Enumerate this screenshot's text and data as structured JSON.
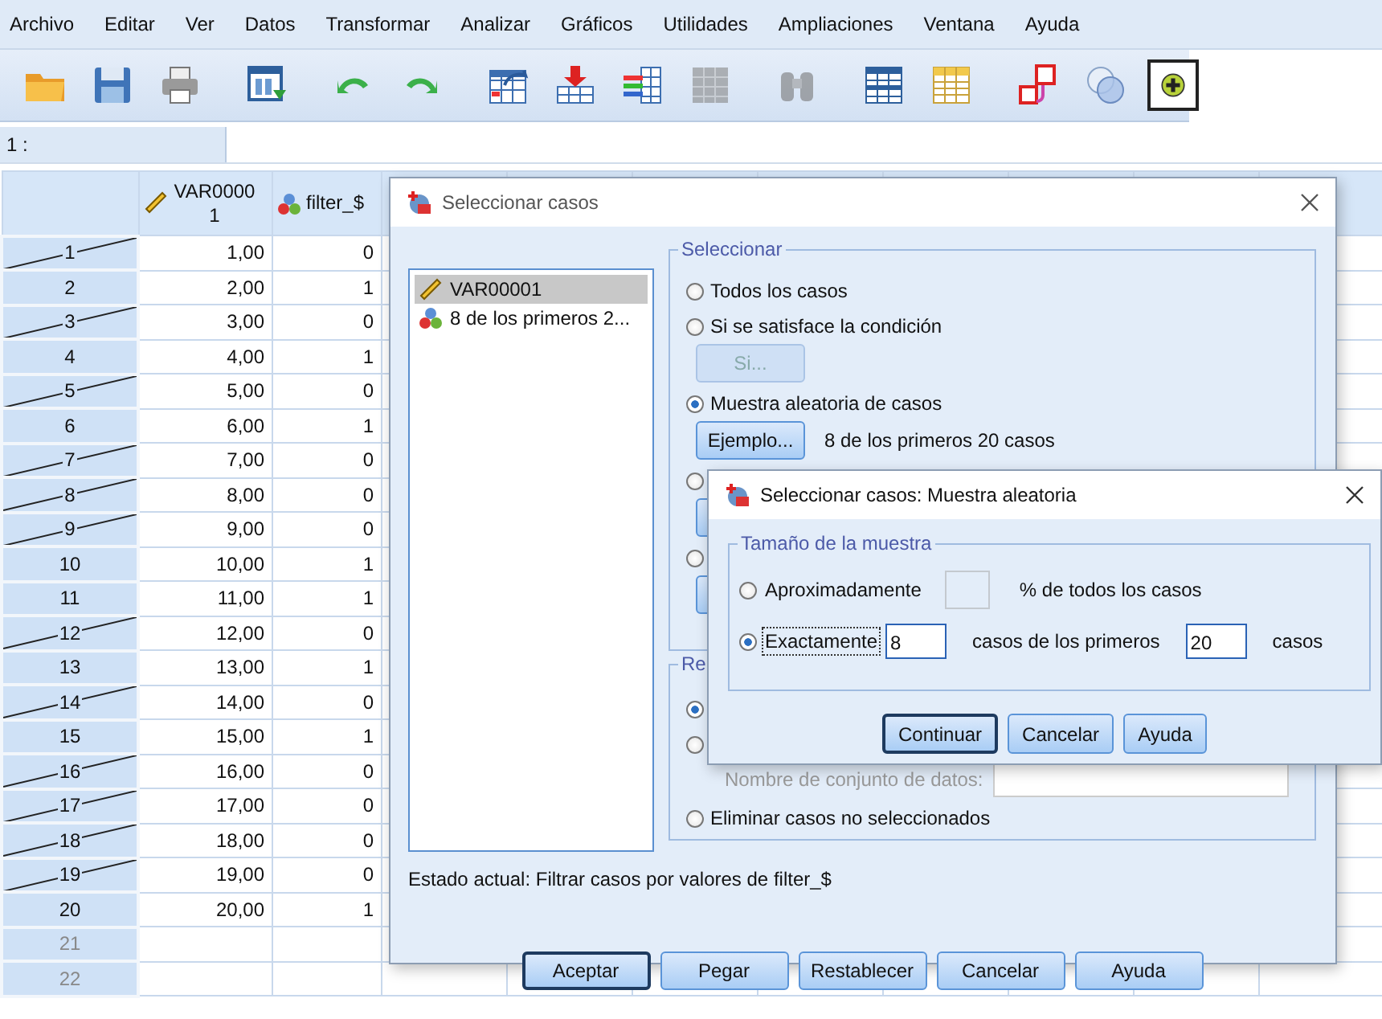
{
  "menu": [
    "Archivo",
    "Editar",
    "Ver",
    "Datos",
    "Transformar",
    "Analizar",
    "Gráficos",
    "Utilidades",
    "Ampliaciones",
    "Ventana",
    "Ayuda"
  ],
  "toolbar": [
    {
      "disabled": false,
      "pressed": false
    },
    {
      "disabled": false,
      "pressed": false
    },
    {
      "disabled": false,
      "pressed": false
    },
    {
      "disabled": false,
      "pressed": false
    },
    {
      "disabled": false,
      "pressed": false
    },
    {
      "disabled": false,
      "pressed": false
    },
    {
      "disabled": false,
      "pressed": false
    },
    {
      "disabled": false,
      "pressed": false
    },
    {
      "disabled": false,
      "pressed": false
    },
    {
      "disabled": true,
      "pressed": false
    },
    {
      "disabled": true,
      "pressed": false
    },
    {
      "disabled": false,
      "pressed": false
    },
    {
      "disabled": false,
      "pressed": false
    },
    {
      "disabled": false,
      "pressed": false
    },
    {
      "disabled": false,
      "pressed": false
    },
    {
      "disabled": false,
      "pressed": true
    }
  ],
  "cell_ref": "1 :",
  "grid": {
    "columns": [
      {
        "name": "VAR00001",
        "kind": "scale"
      },
      {
        "name": "filter_$",
        "kind": "nominal"
      }
    ],
    "rows": [
      {
        "number": "1",
        "filtered_out": true,
        "values": [
          "1,00",
          "0"
        ]
      },
      {
        "number": "2",
        "filtered_out": false,
        "values": [
          "2,00",
          "1"
        ]
      },
      {
        "number": "3",
        "filtered_out": true,
        "values": [
          "3,00",
          "0"
        ]
      },
      {
        "number": "4",
        "filtered_out": false,
        "values": [
          "4,00",
          "1"
        ]
      },
      {
        "number": "5",
        "filtered_out": true,
        "values": [
          "5,00",
          "0"
        ]
      },
      {
        "number": "6",
        "filtered_out": false,
        "values": [
          "6,00",
          "1"
        ]
      },
      {
        "number": "7",
        "filtered_out": true,
        "values": [
          "7,00",
          "0"
        ]
      },
      {
        "number": "8",
        "filtered_out": true,
        "values": [
          "8,00",
          "0"
        ]
      },
      {
        "number": "9",
        "filtered_out": true,
        "values": [
          "9,00",
          "0"
        ]
      },
      {
        "number": "10",
        "filtered_out": false,
        "values": [
          "10,00",
          "1"
        ]
      },
      {
        "number": "11",
        "filtered_out": false,
        "values": [
          "11,00",
          "1"
        ]
      },
      {
        "number": "12",
        "filtered_out": true,
        "values": [
          "12,00",
          "0"
        ]
      },
      {
        "number": "13",
        "filtered_out": false,
        "values": [
          "13,00",
          "1"
        ]
      },
      {
        "number": "14",
        "filtered_out": true,
        "values": [
          "14,00",
          "0"
        ]
      },
      {
        "number": "15",
        "filtered_out": false,
        "values": [
          "15,00",
          "1"
        ]
      },
      {
        "number": "16",
        "filtered_out": true,
        "values": [
          "16,00",
          "0"
        ]
      },
      {
        "number": "17",
        "filtered_out": true,
        "values": [
          "17,00",
          "0"
        ]
      },
      {
        "number": "18",
        "filtered_out": true,
        "values": [
          "18,00",
          "0"
        ]
      },
      {
        "number": "19",
        "filtered_out": true,
        "values": [
          "19,00",
          "0"
        ]
      },
      {
        "number": "20",
        "filtered_out": false,
        "values": [
          "20,00",
          "1"
        ]
      },
      {
        "number": "21",
        "filtered_out": false
      },
      {
        "number": "22",
        "filtered_out": false
      }
    ]
  },
  "dialog": {
    "title": "Seleccionar casos",
    "variables": [
      {
        "label": "VAR00001",
        "kind": "scale",
        "selected": true
      },
      {
        "label": "8 de los primeros 2...",
        "kind": "nominal",
        "selected": false
      }
    ],
    "select_group": {
      "title": "Seleccionar",
      "options": [
        {
          "label": "Todos los casos",
          "selected": false
        },
        {
          "label": "Si se satisface la condición",
          "selected": false,
          "button": {
            "label": "Si...",
            "disabled": true
          }
        },
        {
          "label": "Muestra aleatoria de casos",
          "selected": true,
          "button": {
            "label": "Ejemplo...",
            "disabled": false
          },
          "note": "8 de los primeros 20 casos"
        },
        {
          "selected": false,
          "button": {
            "disabled": false
          }
        },
        {
          "selected": false,
          "button": {
            "disabled": false
          }
        }
      ]
    },
    "output_group": {
      "title": "Re",
      "options": [
        {
          "selected": true
        },
        {
          "selected": false,
          "field": {
            "label": "Nombre de conjunto de datos:",
            "disabled": true
          }
        },
        {
          "label": "Eliminar casos no seleccionados",
          "selected": false
        }
      ]
    },
    "status": "Estado actual: Filtrar casos por valores de filter_$",
    "buttons": [
      {
        "label": "Aceptar",
        "default": true
      },
      {
        "label": "Pegar",
        "default": false
      },
      {
        "label": "Restablecer",
        "default": false
      },
      {
        "label": "Cancelar",
        "default": false
      },
      {
        "label": "Ayuda",
        "default": false
      }
    ]
  },
  "subdialog": {
    "title": "Seleccionar casos: Muestra aleatoria",
    "group_title": "Tamaño de la muestra",
    "options": [
      {
        "kind": "percent",
        "label": "Aproximadamente",
        "selected": false,
        "focused": false,
        "field_disabled": true,
        "suffix": "% de todos los casos"
      },
      {
        "kind": "exact",
        "label": "Exactamente",
        "selected": true,
        "focused": true,
        "value": "8",
        "middle": "casos de los primeros",
        "value2": "20",
        "suffix": "casos"
      }
    ],
    "buttons": [
      {
        "label": "Continuar",
        "default": true
      },
      {
        "label": "Cancelar",
        "default": false
      },
      {
        "label": "Ayuda",
        "default": false
      }
    ]
  }
}
